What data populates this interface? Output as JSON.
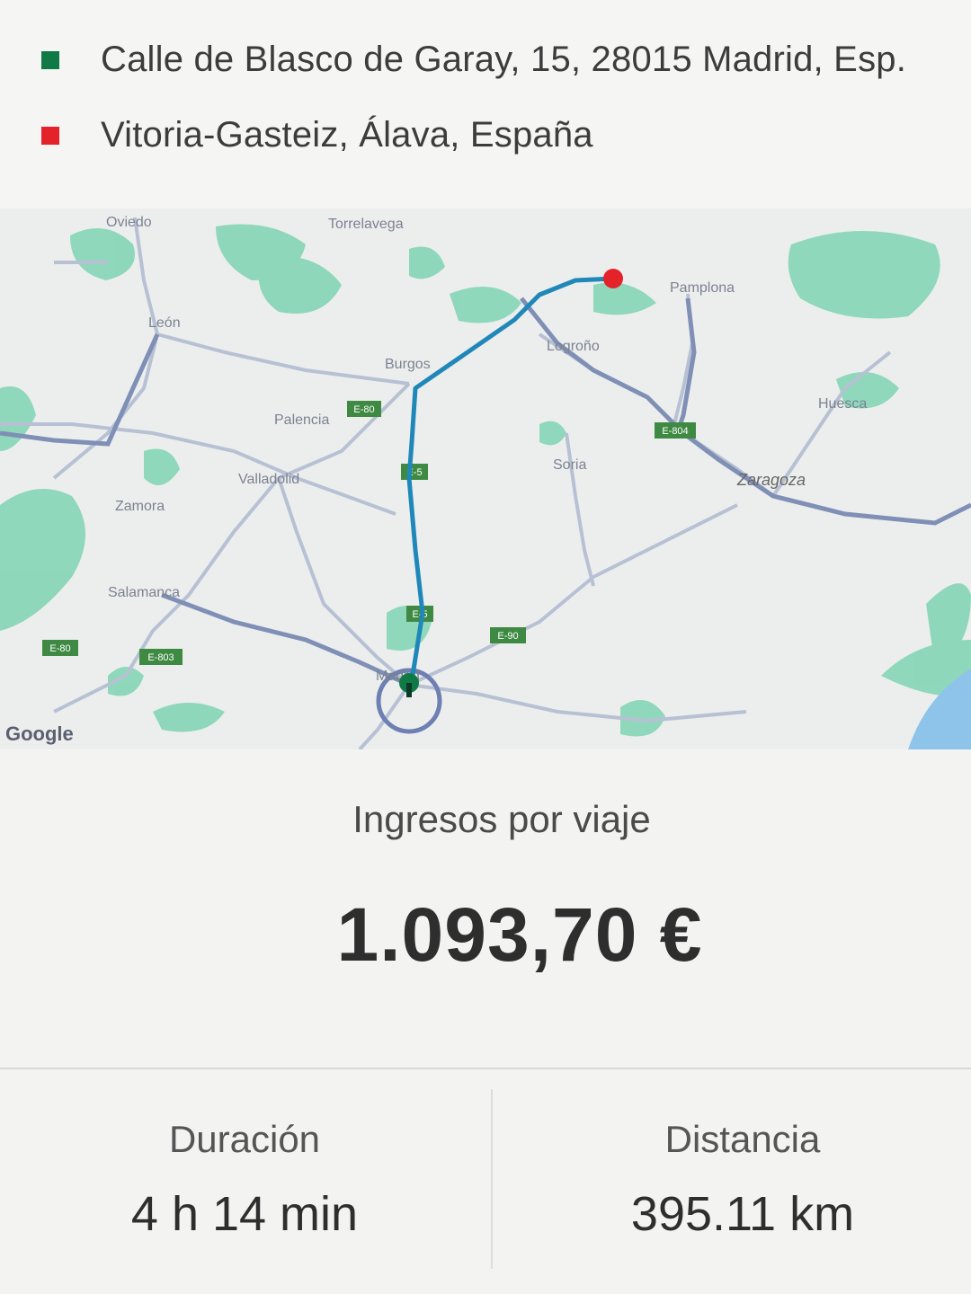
{
  "trip": {
    "pickup": {
      "address": "Calle de Blasco de Garay, 15, 28015 Madrid, Esp.",
      "marker_color": "#0f7a46"
    },
    "dropoff": {
      "address": "Vitoria-Gasteiz, Álava, España",
      "marker_color": "#e4222a"
    }
  },
  "map": {
    "attribution_logo": "Google",
    "route_color": "#1f88b8",
    "city_labels": [
      "Oviedo",
      "Torrelavega",
      "León",
      "Burgos",
      "Logroño",
      "Pamplona",
      "Palencia",
      "Valladolid",
      "Zamora",
      "Salamanca",
      "Soria",
      "Zaragoza",
      "Madrid",
      "Huesca"
    ],
    "road_badges": [
      "E-80",
      "E-5",
      "E-5",
      "E-804",
      "E-90",
      "E-803",
      "E-80"
    ]
  },
  "earnings": {
    "label": "Ingresos por viaje",
    "value": "1.093,70 €"
  },
  "stats": {
    "duration": {
      "label": "Duración",
      "value": "4 h 14 min"
    },
    "distance": {
      "label": "Distancia",
      "value": "395.11 km"
    }
  }
}
